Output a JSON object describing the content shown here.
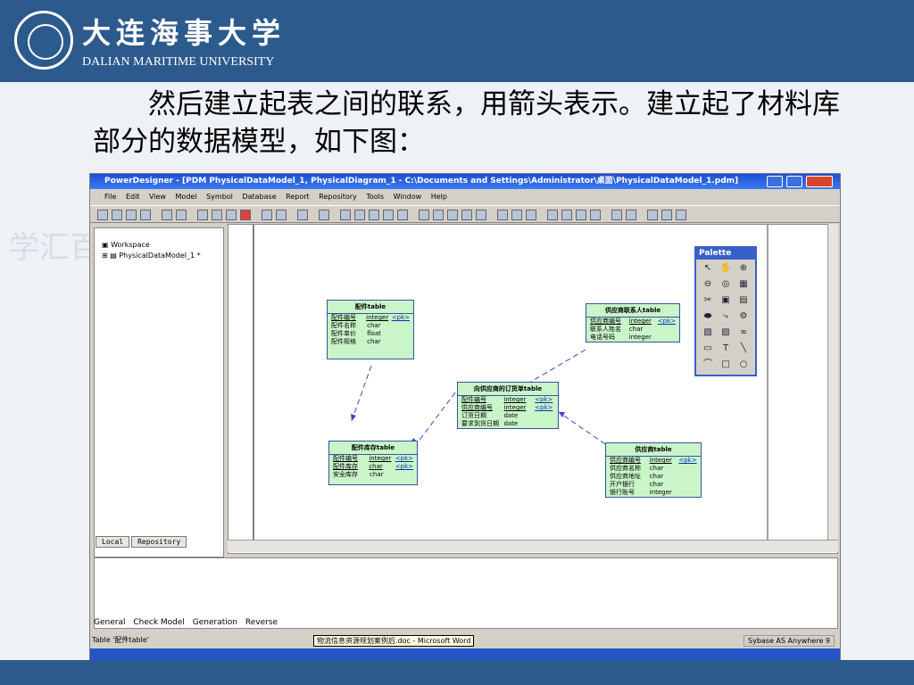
{
  "slide": {
    "university_cn": "大连海事大学",
    "university_en": "DALIAN MARITIME UNIVERSITY",
    "body_text": "然后建立起表之间的联系，用箭头表示。建立起了材料库部分的数据模型，如下图：",
    "watermark": "学汇百川 行水"
  },
  "window": {
    "title": "PowerDesigner - [PDM PhysicalDataModel_1, PhysicalDiagram_1 - C:\\Documents and Settings\\Administrator\\桌面\\PhysicalDataModel_1.pdm]",
    "menus": [
      "File",
      "Edit",
      "View",
      "Model",
      "Symbol",
      "Database",
      "Report",
      "Repository",
      "Tools",
      "Window",
      "Help"
    ],
    "browser": {
      "workspace": "Workspace",
      "model": "PhysicalDataModel_1 *",
      "tabs": [
        "Local",
        "Repository"
      ]
    },
    "palette_title": "Palette",
    "output_tabs": [
      "General",
      "Check Model",
      "Generation",
      "Reverse"
    ],
    "status_left": "Table '配件table'",
    "status_right": "Sybase AS Anywhere 9",
    "word_tip": "物流信息资源规划案例后.doc - Microsoft Word"
  },
  "tables": {
    "t1": {
      "title": "配件table",
      "cols": [
        [
          "配件编号",
          "integer",
          "<pk>"
        ],
        [
          "配件名称",
          "char",
          ""
        ],
        [
          "配件单价",
          "float",
          ""
        ],
        [
          "配件规格",
          "char",
          ""
        ]
      ]
    },
    "t2": {
      "title": "供应商联系人table",
      "cols": [
        [
          "供应商编号",
          "integer",
          "<pk>"
        ],
        [
          "联系人姓名",
          "char",
          ""
        ],
        [
          "电话号码",
          "integer",
          ""
        ]
      ]
    },
    "t3": {
      "title": "向供应商的订货单table",
      "cols": [
        [
          "配件编号",
          "integer",
          "<pk>"
        ],
        [
          "供应商编号",
          "integer",
          "<pk>"
        ],
        [
          "订货日期",
          "date",
          ""
        ],
        [
          "要求到货日期",
          "date",
          ""
        ]
      ]
    },
    "t4": {
      "title": "配件库存table",
      "cols": [
        [
          "配件编号",
          "integer",
          "<pk>"
        ],
        [
          "配件库存",
          "char",
          "<pk>"
        ],
        [
          "安全库存",
          "char",
          ""
        ]
      ]
    },
    "t5": {
      "title": "供应商table",
      "cols": [
        [
          "供应商编号",
          "integer",
          "<pk>"
        ],
        [
          "供应商名称",
          "char",
          ""
        ],
        [
          "供应商地址",
          "char",
          ""
        ],
        [
          "开户银行",
          "char",
          ""
        ],
        [
          "银行账号",
          "integer",
          ""
        ]
      ]
    }
  }
}
